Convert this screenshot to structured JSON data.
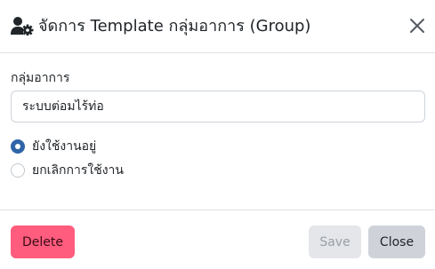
{
  "header": {
    "title": "จัดการ Template กลุ่มอาการ (Group)",
    "icon": "user-gear-icon",
    "close_icon": "close-icon"
  },
  "form": {
    "group_label": "กลุ่มอาการ",
    "group_value": "ระบบต่อมไร้ท่อ",
    "status_options": [
      {
        "label": "ยังใช้งานอยู่",
        "checked": true
      },
      {
        "label": "ยกเลิกการใช้งาน",
        "checked": false
      }
    ]
  },
  "footer": {
    "delete_label": "Delete",
    "save_label": "Save",
    "close_label": "Close"
  },
  "colors": {
    "delete_bg": "#ff5c7e",
    "radio_checked": "#2f64a8",
    "save_disabled_bg": "#e4e6e9",
    "close_bg": "#cfd3d9"
  }
}
